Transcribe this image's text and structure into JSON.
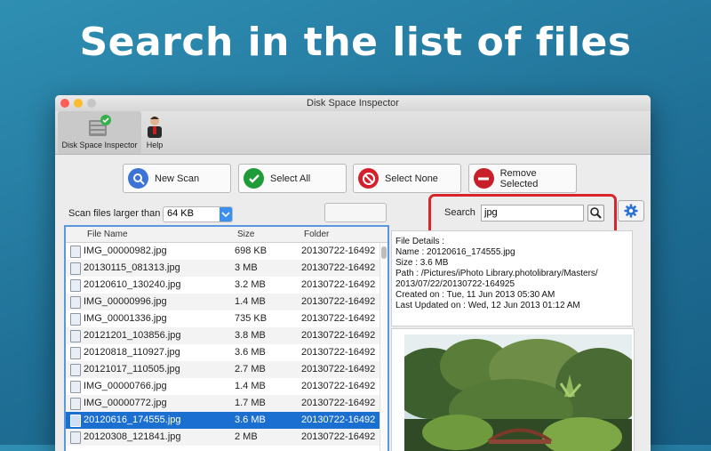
{
  "headline": "Search in the list of files",
  "window": {
    "title": "Disk Space Inspector"
  },
  "toolbar": {
    "items": [
      {
        "label": "Disk Space Inspector",
        "icon": "disk-inspector-icon"
      },
      {
        "label": "Help",
        "icon": "help-person-icon"
      }
    ]
  },
  "actions": {
    "new_scan": "New Scan",
    "select_all": "Select All",
    "select_none": "Select None",
    "remove_selected": "Remove Selected"
  },
  "filter": {
    "label": "Scan files larger than",
    "value": "64 KB"
  },
  "search": {
    "label": "Search",
    "value": "jpg"
  },
  "table": {
    "columns": [
      "File Name",
      "Size",
      "Folder"
    ],
    "rows": [
      {
        "name": "IMG_00000982.jpg",
        "size": "698 KB",
        "folder": "20130722-16492"
      },
      {
        "name": "20130115_081313.jpg",
        "size": "3 MB",
        "folder": "20130722-16492"
      },
      {
        "name": "20120610_130240.jpg",
        "size": "3.2 MB",
        "folder": "20130722-16492"
      },
      {
        "name": "IMG_00000996.jpg",
        "size": "1.4 MB",
        "folder": "20130722-16492"
      },
      {
        "name": "IMG_00001336.jpg",
        "size": "735 KB",
        "folder": "20130722-16492"
      },
      {
        "name": "20121201_103856.jpg",
        "size": "3.8 MB",
        "folder": "20130722-16492"
      },
      {
        "name": "20120818_110927.jpg",
        "size": "3.6 MB",
        "folder": "20130722-16492"
      },
      {
        "name": "20121017_110505.jpg",
        "size": "2.7 MB",
        "folder": "20130722-16492"
      },
      {
        "name": "IMG_00000766.jpg",
        "size": "1.4 MB",
        "folder": "20130722-16492"
      },
      {
        "name": "IMG_00000772.jpg",
        "size": "1.7 MB",
        "folder": "20130722-16492"
      },
      {
        "name": "20120616_174555.jpg",
        "size": "3.6 MB",
        "folder": "20130722-16492",
        "selected": true
      },
      {
        "name": "20120308_121841.jpg",
        "size": "2 MB",
        "folder": "20130722-16492"
      }
    ]
  },
  "details": {
    "heading": "File Details :",
    "name": "Name : 20120616_174555.jpg",
    "size": "Size : 3.6 MB",
    "path1": "Path    :   /Pictures/iPhoto   Library.photolibrary/Masters/",
    "path2": "2013/07/22/20130722-164925",
    "created": "Created on : Tue, 11 Jun 2013 05:30 AM",
    "updated": "Last Updated on : Wed, 12 Jun 2013 01:12 AM"
  },
  "colors": {
    "accent": "#1b6fd0",
    "highlight": "#d9252a",
    "background": "#2580a8"
  }
}
